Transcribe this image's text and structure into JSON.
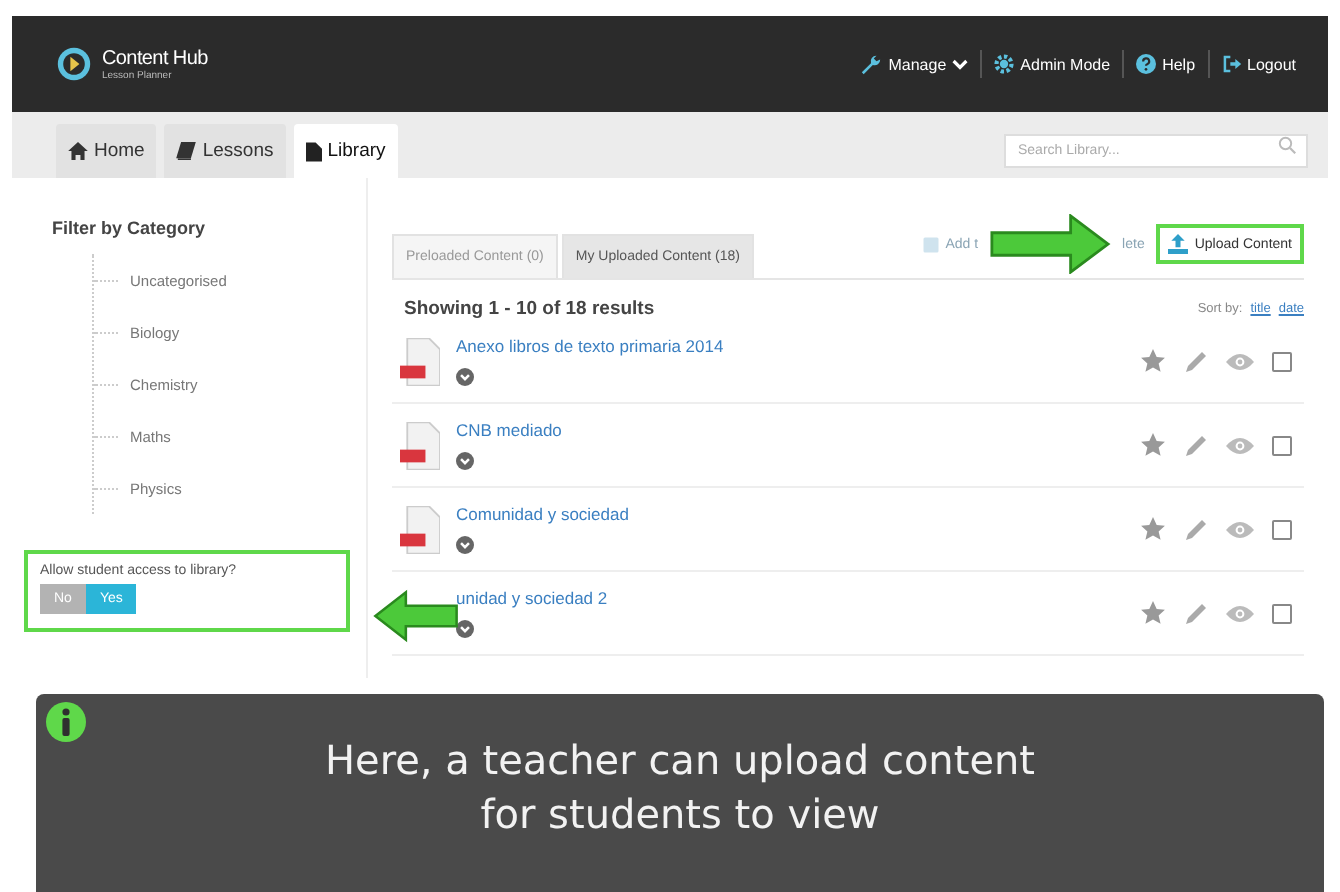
{
  "header": {
    "brand": "Content Hub",
    "subtitle": "Lesson Planner",
    "menu": [
      {
        "kind": "wrench",
        "label": "Manage",
        "dropdown": true
      },
      {
        "kind": "gear",
        "label": "Admin Mode",
        "dropdown": false
      },
      {
        "kind": "help",
        "label": "Help",
        "dropdown": false
      },
      {
        "kind": "logout",
        "label": "Logout",
        "dropdown": false
      }
    ]
  },
  "tabs": [
    {
      "kind": "home",
      "label": "Home",
      "selected": false
    },
    {
      "kind": "book",
      "label": "Lessons",
      "selected": false
    },
    {
      "kind": "file",
      "label": "Library",
      "selected": true
    }
  ],
  "search": {
    "placeholder": "Search Library..."
  },
  "sidebar": {
    "title": "Filter by Category",
    "categories": [
      "Uncategorised",
      "Biology",
      "Chemistry",
      "Maths",
      "Physics"
    ],
    "access": {
      "question": "Allow student access to library?",
      "options": [
        {
          "label": "No",
          "selected": false
        },
        {
          "label": "Yes",
          "selected": true
        }
      ]
    }
  },
  "content_tabs": [
    {
      "label": "Preloaded Content (0)",
      "selected": false
    },
    {
      "label": "My Uploaded Content (18)",
      "selected": true
    }
  ],
  "toolbar": {
    "left_fragment": "Add t",
    "right_fragment": "lete",
    "upload": "Upload Content"
  },
  "results": {
    "heading": "Showing 1 - 10 of 18 results",
    "sort_label": "Sort by:",
    "sort_options": [
      "title",
      "date"
    ]
  },
  "items": [
    {
      "title": "Anexo libros de texto primaria 2014",
      "covered": false,
      "checked": false
    },
    {
      "title": "CNB mediado",
      "covered": false,
      "checked": false
    },
    {
      "title": "Comunidad y sociedad",
      "covered": false,
      "checked": false
    },
    {
      "title": "unidad y sociedad 2",
      "covered": true,
      "checked": false
    }
  ],
  "caption": {
    "lines": [
      "Here, a teacher can upload content",
      "for students to view"
    ]
  }
}
